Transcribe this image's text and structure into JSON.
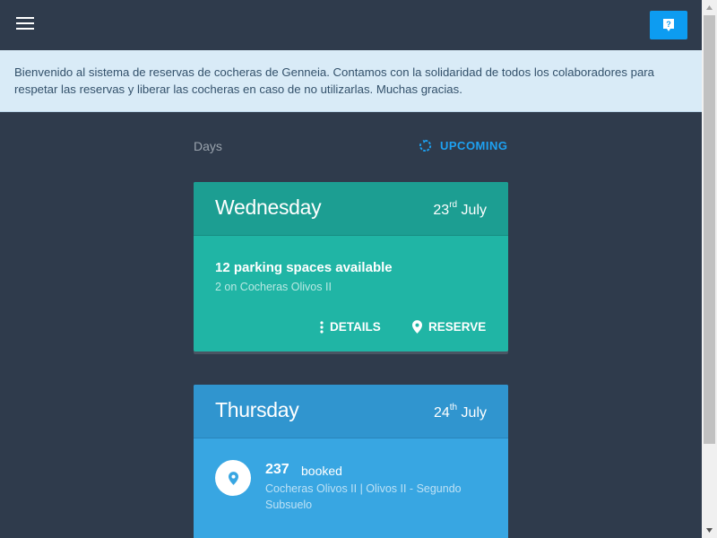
{
  "header": {
    "menu_icon": "hamburger-menu-icon",
    "help_icon": "help-question-icon",
    "help_color": "#0d9cf1"
  },
  "banner": {
    "text": "Bienvenido al sistema de reservas de cocheras de Genneia. Contamos con la solidaridad de todos los colaboradores para respetar las reservas y liberar las cocheras en caso de no utilizarlas. Muchas gracias."
  },
  "days": {
    "label": "Days",
    "filter_icon": "refresh-icon",
    "filter_label": "UPCOMING"
  },
  "cards": [
    {
      "day": "Wednesday",
      "date_num": "23",
      "date_suffix": "rd",
      "month": "July",
      "color": "#20b5a5",
      "spaces_title": "12 parking spaces available",
      "spaces_sub": "2 on Cocheras Olivos II",
      "details_icon": "more-vert-icon",
      "details_label": "DETAILS",
      "reserve_icon": "location-pin-icon",
      "reserve_label": "RESERVE"
    },
    {
      "day": "Thursday",
      "date_num": "24",
      "date_suffix": "th",
      "month": "July",
      "color": "#38a6e2",
      "pin_icon": "location-pin-icon",
      "booked_count": "237",
      "booked_label": "booked",
      "booked_location": "Cocheras Olivos II | Olivos II - Segundo Subsuelo"
    }
  ]
}
